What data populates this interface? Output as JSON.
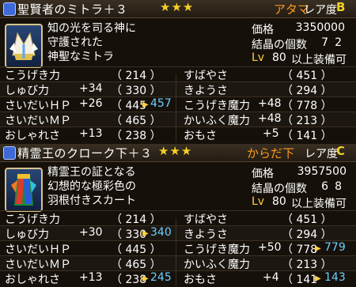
{
  "panels": [
    {
      "title": "聖賢者のミトラ＋３",
      "stars": "★★★",
      "slot": "アタマ",
      "rarity_label": "レア度",
      "rarity_grade": "B",
      "description": [
        "知の光を司る神に",
        "守護された",
        "神聖なミトラ"
      ],
      "info": {
        "price_label": "価格",
        "price_value": "3350000",
        "crystal_label": "結晶の個数",
        "crystal_value": "72",
        "level_prefix": "Lv",
        "level_value": "80",
        "level_suffix": "以上装備可"
      },
      "left_stats": [
        {
          "label": "こうげき力",
          "bonus": "",
          "base": "（ 214 ）",
          "new": ""
        },
        {
          "label": "しゅび力",
          "bonus": "+34",
          "base": "（ 330 ）",
          "new": ""
        },
        {
          "label": "さいだいＨＰ",
          "bonus": "+26",
          "base": "（ 445",
          "new": "457"
        },
        {
          "label": "さいだいＭＰ",
          "bonus": "",
          "base": "（ 465 ）",
          "new": ""
        },
        {
          "label": "おしゃれさ",
          "bonus": "+13",
          "base": "（ 238 ）",
          "new": ""
        }
      ],
      "right_stats": [
        {
          "label": "すばやさ",
          "bonus": "",
          "base": "（ 451 ）",
          "new": ""
        },
        {
          "label": "きようさ",
          "bonus": "",
          "base": "（ 294 ）",
          "new": ""
        },
        {
          "label": "こうげき魔力",
          "bonus": "+48",
          "base": "（ 778 ）",
          "new": ""
        },
        {
          "label": "かいふく魔力",
          "bonus": "+48",
          "base": "（ 213 ）",
          "new": ""
        },
        {
          "label": "おもさ",
          "bonus": "+5",
          "base": "（ 141 ）",
          "new": ""
        }
      ]
    },
    {
      "title": "精霊王のクローク下＋３",
      "stars": "★★★",
      "slot": "からだ下",
      "rarity_label": "レア度",
      "rarity_grade": "C",
      "description": [
        "精霊王の証となる",
        "幻想的な極彩色の",
        "羽根付きスカート"
      ],
      "info": {
        "price_label": "価格",
        "price_value": "3957500",
        "crystal_label": "結晶の個数",
        "crystal_value": "68",
        "level_prefix": "Lv",
        "level_value": "80",
        "level_suffix": "以上装備可"
      },
      "left_stats": [
        {
          "label": "こうげき力",
          "bonus": "",
          "base": "（ 214 ）",
          "new": ""
        },
        {
          "label": "しゅび力",
          "bonus": "+30",
          "base": "（ 330",
          "new": "340"
        },
        {
          "label": "さいだいＨＰ",
          "bonus": "",
          "base": "（ 445 ）",
          "new": ""
        },
        {
          "label": "さいだいＭＰ",
          "bonus": "",
          "base": "（ 465 ）",
          "new": ""
        },
        {
          "label": "おしゃれさ",
          "bonus": "+13",
          "base": "（ 238",
          "new": "245"
        }
      ],
      "right_stats": [
        {
          "label": "すばやさ",
          "bonus": "",
          "base": "（ 451 ）",
          "new": ""
        },
        {
          "label": "きようさ",
          "bonus": "",
          "base": "（ 294 ）",
          "new": ""
        },
        {
          "label": "こうげき魔力",
          "bonus": "+50",
          "base": "（ 778",
          "new": "779"
        },
        {
          "label": "かいふく魔力",
          "bonus": "",
          "base": "（ 213 ）",
          "new": ""
        },
        {
          "label": "おもさ",
          "bonus": "+4",
          "base": "（ 141",
          "new": "143"
        }
      ]
    }
  ],
  "icons": {
    "panel_type_icon": "armor-type-icon",
    "item_1": "mitre-helmet-icon",
    "item_2": "feathered-skirt-icon",
    "changed_arrow": "triangle-right-icon"
  },
  "colors": {
    "slot": "#ff9a1c",
    "stars": "#f2d028",
    "new_value": "#6ad0ff"
  }
}
